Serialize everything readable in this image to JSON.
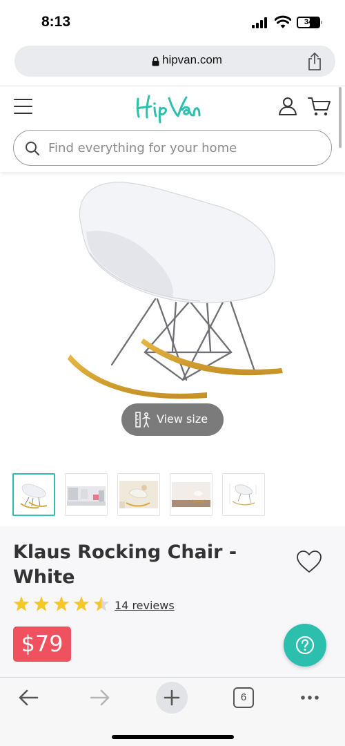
{
  "status_bar": {
    "time": "8:13",
    "battery": "34"
  },
  "browser": {
    "url": "hipvan.com",
    "tab_count": "6"
  },
  "header": {
    "logo_text": "HipVan",
    "search_placeholder": "Find everything for your home"
  },
  "product": {
    "view_size_label": "View size",
    "title": "Klaus Rocking Chair - White",
    "rating": 4.5,
    "rating_max": 5,
    "reviews_label": "14 reviews",
    "price": "$79"
  },
  "colors": {
    "brand_teal": "#2cbfae",
    "price_red": "#f0515f",
    "star_yellow": "#f5c827"
  }
}
